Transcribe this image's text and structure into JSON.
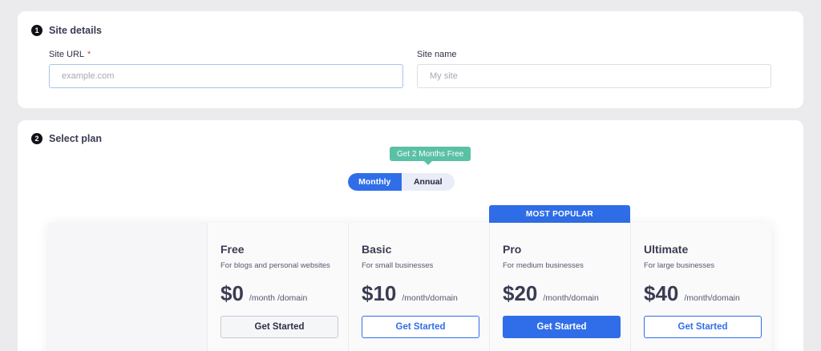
{
  "site_details": {
    "step_number": "1",
    "title": "Site details",
    "url_label": "Site URL",
    "url_required_mark": "*",
    "url_placeholder": "example.com",
    "url_value": "",
    "name_label": "Site name",
    "name_placeholder": "My site",
    "name_value": ""
  },
  "select_plan": {
    "step_number": "2",
    "title": "Select plan",
    "promo_badge": "Get 2 Months Free",
    "billing_toggle": {
      "options": [
        "Monthly",
        "Annual"
      ],
      "selected": "Monthly"
    },
    "popular_ribbon": "MOST POPULAR",
    "plans": [
      {
        "name": "Free",
        "description": "For blogs and personal websites",
        "price": "$0",
        "period": "/month /domain",
        "button": "Get Started"
      },
      {
        "name": "Basic",
        "description": "For small businesses",
        "price": "$10",
        "period": "/month/domain",
        "button": "Get Started"
      },
      {
        "name": "Pro",
        "description": "For medium businesses",
        "price": "$20",
        "period": "/month/domain",
        "button": "Get Started"
      },
      {
        "name": "Ultimate",
        "description": "For large businesses",
        "price": "$40",
        "period": "/month/domain",
        "button": "Get Started"
      }
    ]
  },
  "colors": {
    "accent": "#2f6ee8",
    "promo": "#5ac0a6",
    "background": "#ebebed",
    "required": "#e0443a"
  }
}
